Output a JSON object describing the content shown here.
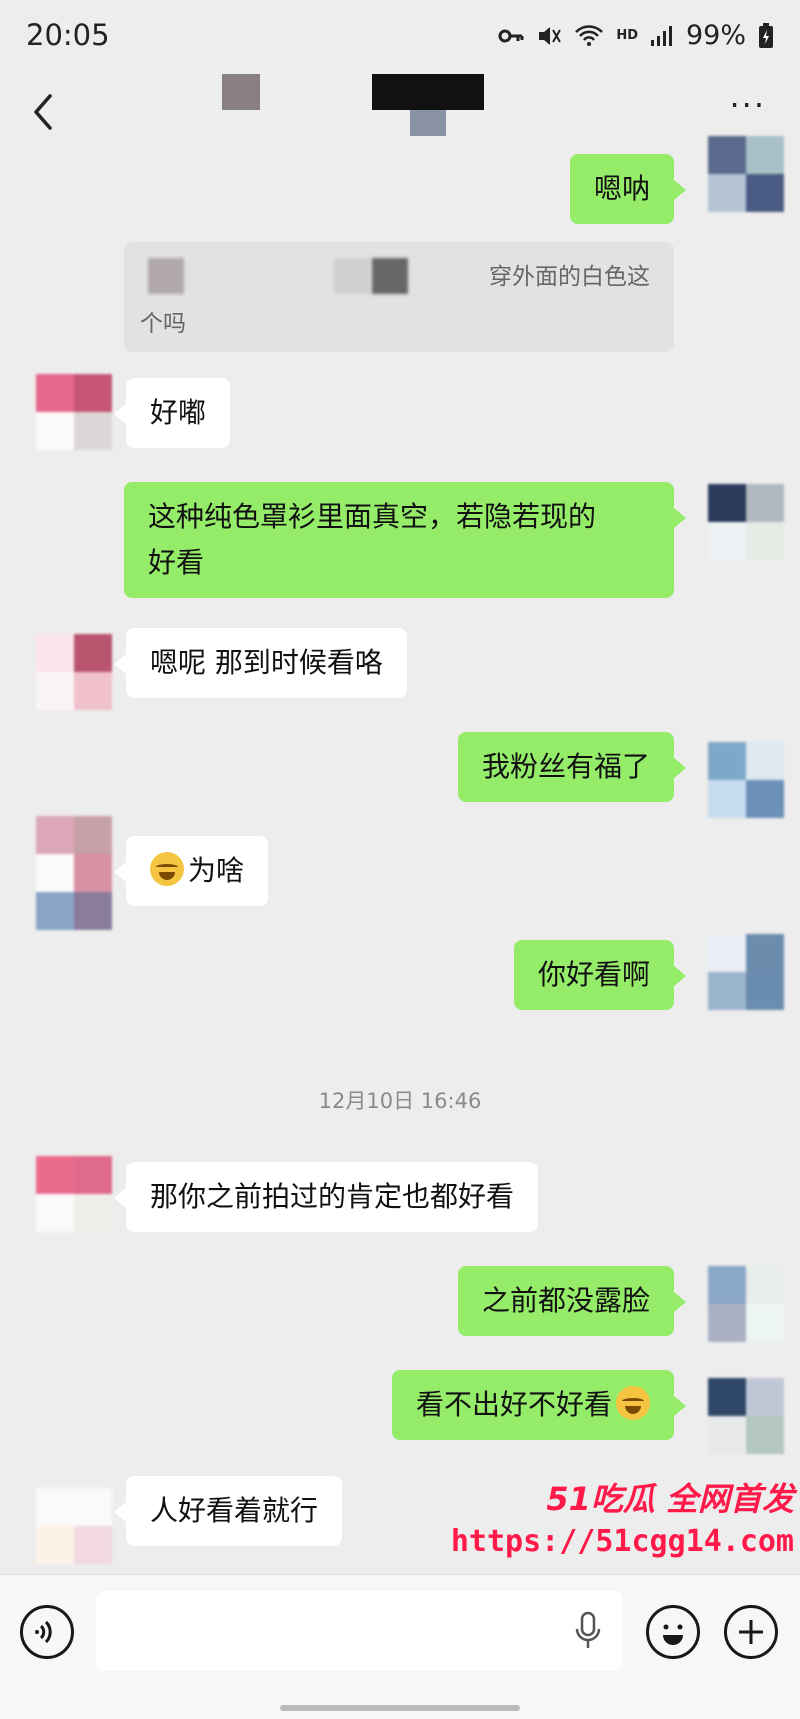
{
  "status_bar": {
    "time": "20:05",
    "battery": "99%",
    "network": "HD"
  },
  "header": {
    "more_label": "···"
  },
  "chat": {
    "messages": [
      {
        "from": "me",
        "text": "嗯呐"
      },
      {
        "from": "quote",
        "text_a": "穿外面的白色这",
        "text_b": "个吗"
      },
      {
        "from": "them",
        "text": "好嘟"
      },
      {
        "from": "me",
        "text_line1": "这种纯色罩衫里面真空，若隐若现的",
        "text_line2": "好看"
      },
      {
        "from": "them",
        "text": "嗯呢 那到时候看咯"
      },
      {
        "from": "me",
        "text": "我粉丝有福了"
      },
      {
        "from": "them",
        "text": "为啥"
      },
      {
        "from": "me",
        "text": "你好看啊"
      },
      {
        "from": "them",
        "text": "那你之前拍过的肯定也都好看"
      },
      {
        "from": "me",
        "text": "之前都没露脸"
      },
      {
        "from": "me",
        "text": "看不出好不好看"
      },
      {
        "from": "them",
        "text": "人好看着就行"
      }
    ],
    "timestamp": "12月10日 16:46"
  },
  "watermark": {
    "line1": "51吃瓜 全网首发",
    "line2": "https://51cgg14.com"
  },
  "colors": {
    "my_bubble": "#95ec69",
    "their_bubble": "#ffffff",
    "background": "#ededed",
    "watermark": "#ff1a4a"
  },
  "icons": [
    "back-arrow-icon",
    "more-icon",
    "voice-mode-icon",
    "mic-icon",
    "emoji-icon",
    "plus-icon",
    "laughing-tears-emoji"
  ]
}
